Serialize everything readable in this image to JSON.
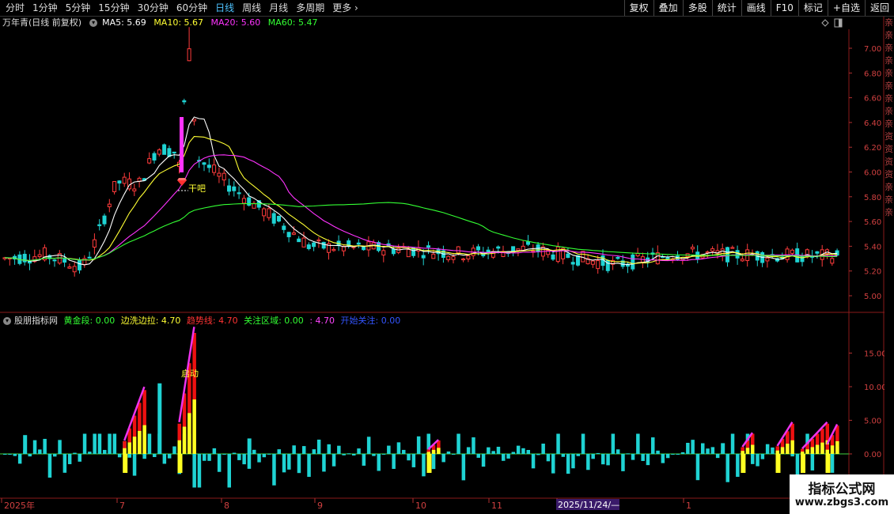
{
  "toolbar": {
    "periods": [
      "分时",
      "1分钟",
      "5分钟",
      "15分钟",
      "30分钟",
      "60分钟",
      "日线",
      "周线",
      "月线",
      "多周期",
      "更多"
    ],
    "active_period": "日线",
    "buttons": [
      "复权",
      "叠加",
      "多股",
      "统计",
      "画线",
      "F10",
      "标记",
      "+自选",
      "返回"
    ]
  },
  "stock": {
    "title": "万年青(日线 前复权)",
    "ma5_label": "MA5: 5.69",
    "ma10_label": "MA10: 5.67",
    "ma20_label": "MA20: 5.60",
    "ma60_label": "MA60: 5.47",
    "annotation": "干吧"
  },
  "indicator": {
    "name": "股朋指标网",
    "items": [
      {
        "text": "黄金段: 0.00",
        "color": "#33ff33"
      },
      {
        "text": "边洗边拉: 4.70",
        "color": "#ffff33"
      },
      {
        "text": "趋势线: 4.70",
        "color": "#ff3333"
      },
      {
        "text": "关注区域: 0.00",
        "color": "#33ff33"
      },
      {
        "text": ": 4.70",
        "color": "#ff44ff"
      },
      {
        "text": "开始关注: 0.00",
        "color": "#3355ff"
      }
    ],
    "annotation": "启动"
  },
  "price_axis": [
    "7.00",
    "6.80",
    "6.60",
    "6.40",
    "6.20",
    "6.00",
    "5.80",
    "5.60",
    "5.40",
    "5.20",
    "5.00"
  ],
  "ind_axis": [
    "15.00",
    "10.00",
    "5.00",
    "0.00"
  ],
  "dates": [
    "2025年",
    "7",
    "8",
    "9",
    "10",
    "11",
    "2025/11/24/—",
    "1"
  ],
  "colors": {
    "up": "#ff3b3b",
    "down": "#1fd3d3",
    "ma5": "#ffffff",
    "ma10": "#ffff33",
    "ma20": "#ff33ff",
    "ma60": "#33ff33"
  },
  "right_strip": "亲亲亲亲亲亲亲亲亲资资资资亲亲亲",
  "watermark": {
    "line1": "指标公式网",
    "line2": "www.zbgs3.com"
  }
}
